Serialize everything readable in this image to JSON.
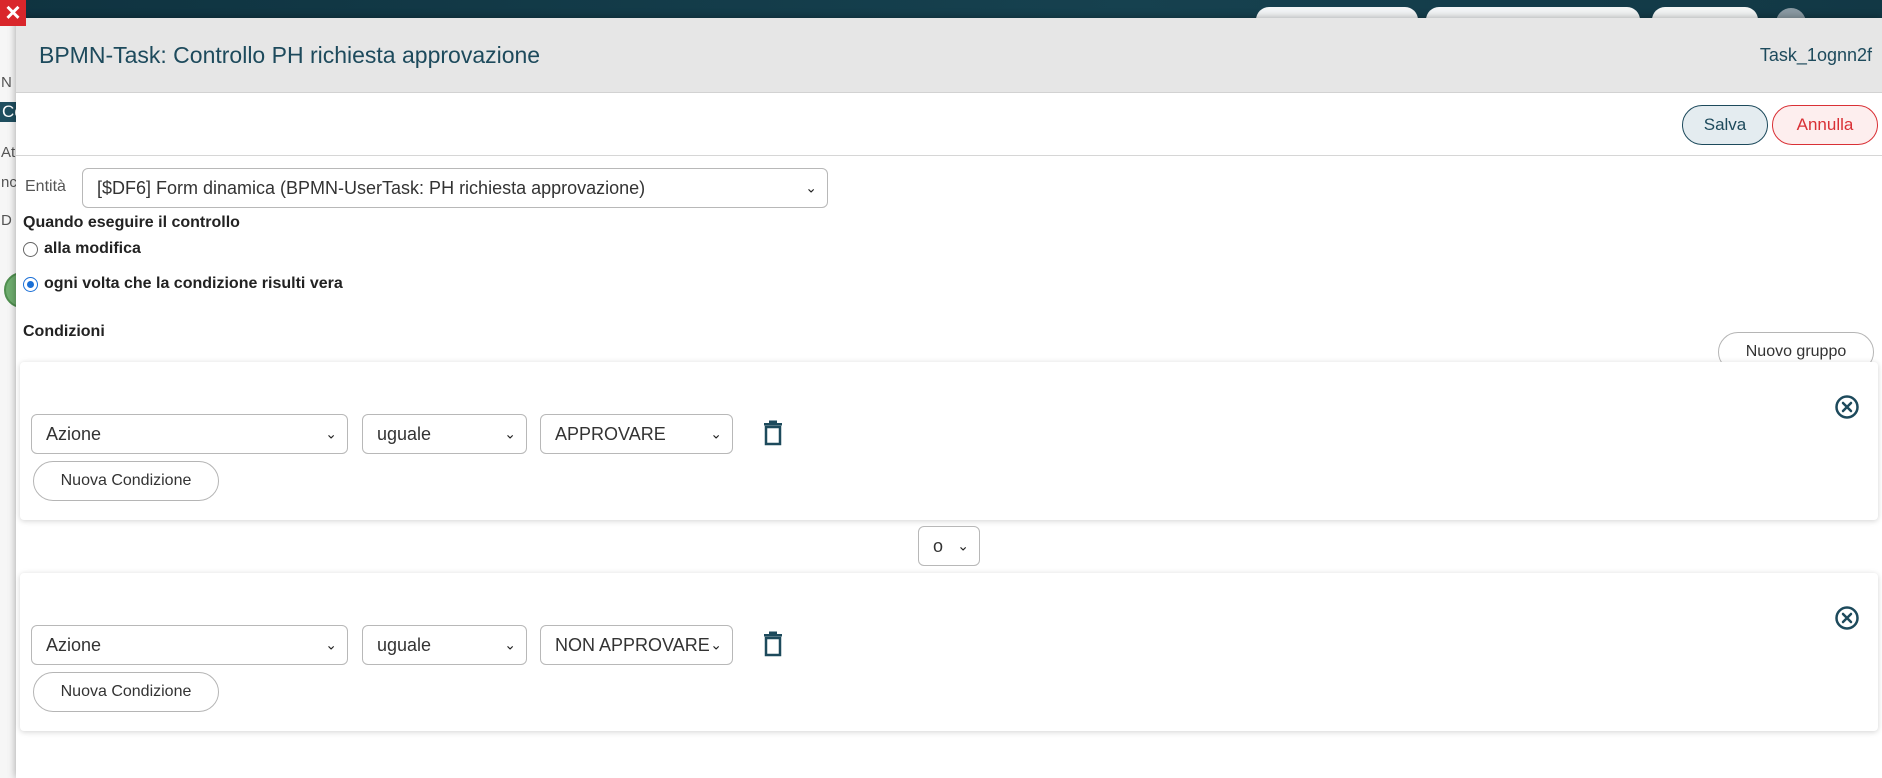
{
  "modal": {
    "title": "BPMN-Task: Controllo PH richiesta approvazione",
    "task_id": "Task_1ognn2f"
  },
  "toolbar": {
    "save_label": "Salva",
    "cancel_label": "Annulla"
  },
  "entity": {
    "label": "Entità",
    "selected": "[$DF6] Form dinamica (BPMN-UserTask: PH richiesta approvazione)"
  },
  "when": {
    "label": "Quando eseguire il controllo",
    "options": [
      {
        "label": "alla modifica",
        "checked": false
      },
      {
        "label": "ogni volta che la condizione risulti vera",
        "checked": true
      }
    ]
  },
  "conditions": {
    "label": "Condizioni",
    "new_group_label": "Nuovo gruppo",
    "new_condition_label": "Nuova Condizione",
    "joiner": "o",
    "groups": [
      {
        "field": "Azione",
        "operator": "uguale",
        "value": "APPROVARE"
      },
      {
        "field": "Azione",
        "operator": "uguale",
        "value": "NON APPROVARE"
      }
    ]
  },
  "background": {
    "fragments": [
      "N",
      "Co",
      "At",
      "nc",
      "D"
    ]
  },
  "colors": {
    "primary": "#1d4a5c",
    "danger": "#d93035",
    "radio_checked": "#1a6fd6"
  }
}
